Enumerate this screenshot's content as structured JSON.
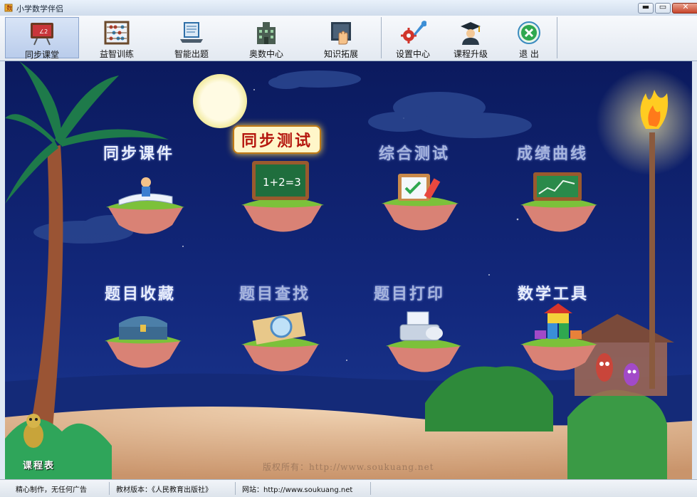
{
  "window": {
    "title": "小学数学伴侣",
    "buttons": {
      "minimize": "▬",
      "maximize": "▭",
      "close": "✕"
    }
  },
  "toolbar": {
    "items": [
      {
        "label": "同步课堂",
        "icon": "blackboard-icon",
        "active": true
      },
      {
        "label": "益智训练",
        "icon": "abacus-icon",
        "active": false
      },
      {
        "label": "智能出题",
        "icon": "laptop-icon",
        "active": false
      },
      {
        "label": "奥数中心",
        "icon": "building-icon",
        "active": false
      },
      {
        "label": "知识拓展",
        "icon": "book-hand-icon",
        "active": false
      },
      {
        "label": "设置中心",
        "icon": "gear-wrench-icon",
        "active": false
      },
      {
        "label": "课程升级",
        "icon": "graduate-icon",
        "active": false
      },
      {
        "label": "退  出",
        "icon": "exit-icon",
        "active": false
      }
    ]
  },
  "main_menu": {
    "items": [
      {
        "label": "同步课件",
        "icon": "book-reader-icon"
      },
      {
        "label": "同步测试",
        "icon": "chalkboard-icon",
        "highlighted": true
      },
      {
        "label": "综合测试",
        "icon": "clipboard-icon"
      },
      {
        "label": "成绩曲线",
        "icon": "line-chart-icon"
      },
      {
        "label": "题目收藏",
        "icon": "treasure-chest-icon"
      },
      {
        "label": "题目查找",
        "icon": "magnifier-icon"
      },
      {
        "label": "题目打印",
        "icon": "printer-icon"
      },
      {
        "label": "数学工具",
        "icon": "building-blocks-icon"
      }
    ],
    "chalkboard_text": "1+2=3"
  },
  "scene": {
    "schedule_label": "课程表",
    "copyright": "版权所有：http://www.soukuang.net"
  },
  "statusbar": {
    "items": [
      "精心制作，无任何广告",
      "教材版本：《人民教育出版社》",
      "网站：http://www.soukuang.net"
    ]
  },
  "colors": {
    "sky": "#0e1f66",
    "highlight_text": "#b5170e",
    "sand": "#d9b48f"
  }
}
